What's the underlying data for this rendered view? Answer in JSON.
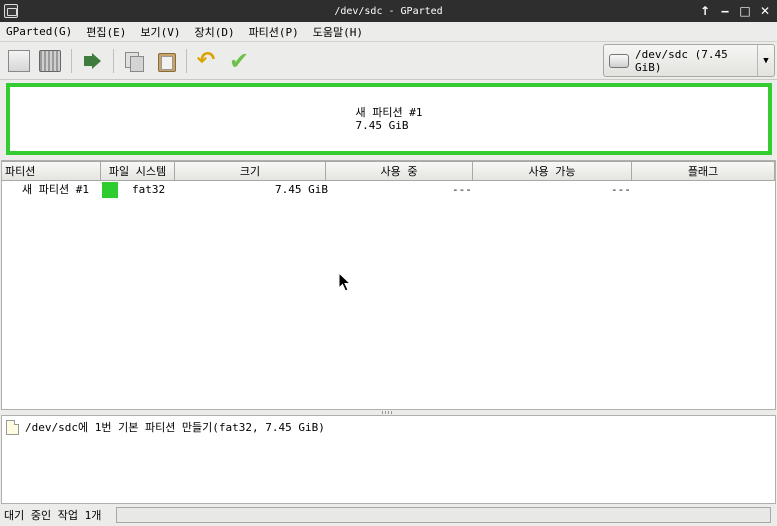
{
  "window": {
    "title": "/dev/sdc - GParted",
    "buttons": [
      "↑",
      "‒",
      "□",
      "✕"
    ]
  },
  "menubar": {
    "items": [
      "GParted(G)",
      "편집(E)",
      "보기(V)",
      "장치(D)",
      "파티션(P)",
      "도움말(H)"
    ]
  },
  "toolbar": {
    "icons": [
      "new-icon",
      "delete-icon",
      "resize-move-icon",
      "copy-icon",
      "paste-icon",
      "undo-icon",
      "apply-icon"
    ],
    "undo_glyph": "↶",
    "apply_glyph": "✔"
  },
  "device": {
    "label": "/dev/sdc   (7.45 GiB)",
    "arrow": "▼"
  },
  "diskmap": {
    "partition_name": "새 파티션 #1",
    "partition_size": "7.45 GiB",
    "color": "#33cc33"
  },
  "table": {
    "columns": [
      "파티션",
      "파일 시스템",
      "크기",
      "사용 중",
      "사용 가능",
      "플래그"
    ],
    "rows": [
      {
        "partition": "새 파티션 #1",
        "filesystem": "fat32",
        "fs_color": "#2ecc2e",
        "size": "7.45 GiB",
        "used": "---",
        "unused": "---",
        "flags": ""
      }
    ]
  },
  "operations": {
    "items": [
      "/dev/sdc에 1번 기본 파티션 만들기(fat32, 7.45 GiB)"
    ]
  },
  "status": {
    "text": "대기 중인 작업 1개"
  }
}
